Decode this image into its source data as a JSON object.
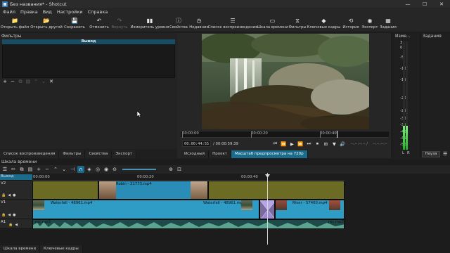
{
  "window": {
    "title": "Без названия* - Shotcut",
    "minimize": "—",
    "maximize": "☐",
    "close": "✕"
  },
  "menu": [
    "Файл",
    "Правка",
    "Вид",
    "Настройки",
    "Справка"
  ],
  "toolbar": [
    {
      "label": "Открыть файл",
      "icon": "folder-icon",
      "glyph": "📁",
      "enabled": true
    },
    {
      "label": "Открыть другой",
      "icon": "folder-open-icon",
      "glyph": "📂",
      "enabled": true
    },
    {
      "label": "Сохранить",
      "icon": "save-icon",
      "glyph": "💾",
      "enabled": true
    },
    {
      "label": "Отменить",
      "icon": "undo-icon",
      "glyph": "↶",
      "enabled": true
    },
    {
      "label": "Вернуть",
      "icon": "redo-icon",
      "glyph": "↷",
      "enabled": false
    },
    {
      "label": "Измеритель уровня",
      "icon": "level-meter-icon",
      "glyph": "▮▮",
      "enabled": true
    },
    {
      "label": "Свойства",
      "icon": "info-icon",
      "glyph": "ⓘ",
      "enabled": true
    },
    {
      "label": "Недавние",
      "icon": "recent-icon",
      "glyph": "◷",
      "enabled": true
    },
    {
      "label": "Список воспроизведения",
      "icon": "playlist-icon",
      "glyph": "☰",
      "enabled": true
    },
    {
      "label": "Шкала времени",
      "icon": "timeline-icon",
      "glyph": "▭",
      "enabled": true
    },
    {
      "label": "Фильтры",
      "icon": "filters-icon",
      "glyph": "⧖",
      "enabled": true
    },
    {
      "label": "Ключевые кадры",
      "icon": "keyframes-icon",
      "glyph": "◆",
      "enabled": true
    },
    {
      "label": "История",
      "icon": "history-icon",
      "glyph": "⟲",
      "enabled": true
    },
    {
      "label": "Экспорт",
      "icon": "export-icon",
      "glyph": "◉",
      "enabled": true
    },
    {
      "label": "Задания",
      "icon": "jobs-icon",
      "glyph": "▦",
      "enabled": true
    }
  ],
  "filters": {
    "title": "Фильтры",
    "header": "Вывод",
    "buttons": [
      {
        "name": "add-filter-button",
        "glyph": "+",
        "enabled": true
      },
      {
        "name": "remove-filter-button",
        "glyph": "−",
        "enabled": true
      },
      {
        "name": "copy-filter-button",
        "glyph": "⧉",
        "enabled": false
      },
      {
        "name": "paste-filter-button",
        "glyph": "▤",
        "enabled": false
      },
      {
        "name": "move-up-button",
        "glyph": "⌃",
        "enabled": false
      },
      {
        "name": "move-down-button",
        "glyph": "⌄",
        "enabled": false
      },
      {
        "name": "deselect-filter-button",
        "glyph": "✕",
        "enabled": true
      }
    ]
  },
  "left_tabs": [
    "Список воспроизведения",
    "Фильтры",
    "Свойства",
    "Экспорт"
  ],
  "player": {
    "ruler": [
      "00:00:00",
      "00:00:20",
      "00:00:40"
    ],
    "position": "00:00:44:55",
    "duration": "/ 00:00:59:39",
    "in_point": "--:--:--:-- /",
    "out_point": "--:--:--:--",
    "controls": [
      "⏮",
      "⏪",
      "▶",
      "⏩",
      "⏭",
      "⏹",
      "⊞",
      "▼",
      "🔊"
    ],
    "tabs": [
      "Исходный",
      "Проект",
      "Масштаб предпросмотра на 720р"
    ]
  },
  "meter": {
    "title": "Изме...",
    "scale": [
      "3",
      "0",
      "-5",
      "-10",
      "-15",
      "-20",
      "-25",
      "-30",
      "-35",
      "-40",
      "-45",
      "-50"
    ],
    "left_label": "L",
    "right_label": "R",
    "left_level": 0.22,
    "right_level": 0.22
  },
  "jobs": {
    "title": "Задания",
    "pause": "Пауза"
  },
  "timeline": {
    "title": "Шкала времени",
    "ruler": [
      "00:00:00",
      "00:00:20",
      "00:00:40"
    ],
    "tracks": [
      {
        "name": "Вывод"
      },
      {
        "name": "V2"
      },
      {
        "name": "V1"
      },
      {
        "name": "A1"
      }
    ],
    "clips": {
      "robin": "Robin - 21773.mp4",
      "waterfall_a": "Waterfall - 48961.mp4",
      "waterfall_b": "Waterfall - 48961.mp4",
      "river": "River - 57400.mp4",
      "rec_a": "rec.mp3",
      "rec_b": "rec.mp3"
    }
  },
  "bottom_tabs": [
    "Шкала времени",
    "Ключевые кадры"
  ]
}
